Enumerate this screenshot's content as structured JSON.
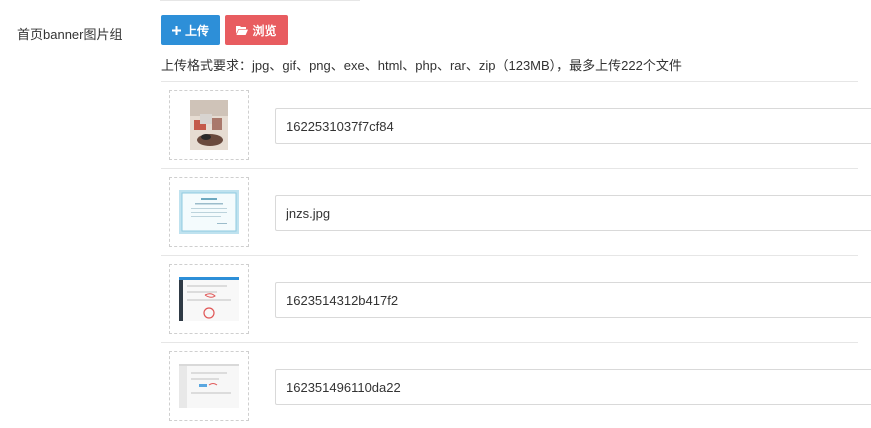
{
  "field": {
    "label": "首页banner图片组",
    "upload_label": "上传",
    "browse_label": "浏览",
    "hint": "上传格式要求：jpg、gif、png、exe、html、php、rar、zip（123MB），最多上传222个文件"
  },
  "icons": {
    "upload": "plus-icon",
    "browse": "folder-open-icon"
  },
  "colors": {
    "upload_button": "#2d8fd8",
    "browse_button": "#e85c60"
  },
  "images": [
    {
      "name": "1622531037f7cf84",
      "thumb": "photo-thumbnail"
    },
    {
      "name": "jnzs.jpg",
      "thumb": "certificate-thumbnail"
    },
    {
      "name": "1623514312b417f2",
      "thumb": "screenshot-thumbnail"
    },
    {
      "name": "162351496110da22",
      "thumb": "screenshot-thumbnail"
    }
  ]
}
